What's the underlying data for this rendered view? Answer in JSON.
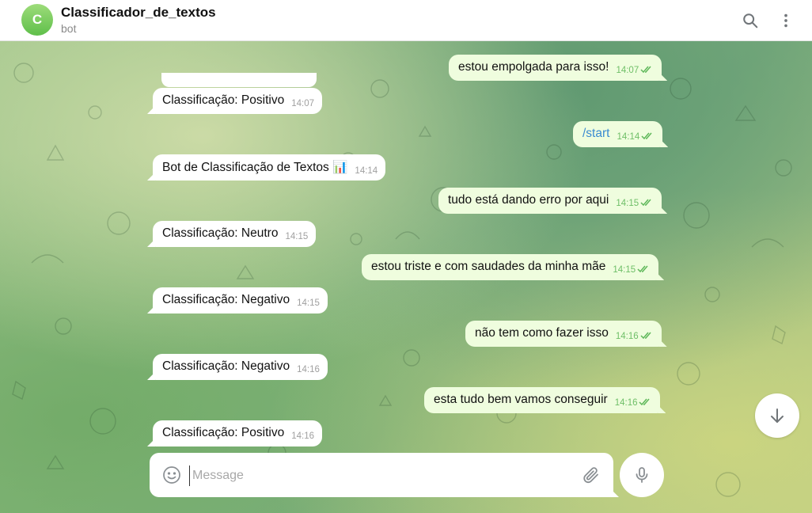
{
  "header": {
    "avatar_letter": "C",
    "title": "Classificador_de_textos",
    "subtitle": "bot",
    "search_icon": "search-icon",
    "menu_icon": "more-vertical-icon"
  },
  "messages": [
    {
      "dir": "out",
      "text": "estou empolgada para isso!",
      "time": "14:07"
    },
    {
      "dir": "in",
      "text": "Classificação: Positivo",
      "time": "14:07"
    },
    {
      "dir": "out",
      "text": "/start",
      "time": "14:14"
    },
    {
      "dir": "in",
      "text": "Bot de Classificação de Textos 📊",
      "time": "14:14"
    },
    {
      "dir": "out",
      "text": "tudo está dando erro por aqui",
      "time": "14:15"
    },
    {
      "dir": "in",
      "text": "Classificação: Neutro",
      "time": "14:15"
    },
    {
      "dir": "out",
      "text": "estou triste e com saudades da minha mãe",
      "time": "14:15"
    },
    {
      "dir": "in",
      "text": "Classificação: Negativo",
      "time": "14:15"
    },
    {
      "dir": "out",
      "text": "não tem como fazer isso",
      "time": "14:16"
    },
    {
      "dir": "in",
      "text": "Classificação: Negativo",
      "time": "14:16"
    },
    {
      "dir": "out",
      "text": "esta tudo bem vamos conseguir",
      "time": "14:16"
    },
    {
      "dir": "in",
      "text": "Classificação: Positivo",
      "time": "14:16"
    }
  ],
  "composer": {
    "placeholder": "Message",
    "value": "",
    "emoji_icon": "smiley-icon",
    "attach_icon": "paperclip-icon",
    "mic_icon": "microphone-icon"
  },
  "scroll_down_icon": "arrow-down-icon",
  "colors": {
    "incoming_bubble": "#ffffff",
    "outgoing_bubble": "#effdde",
    "outgoing_meta": "#6fbf68",
    "command_link": "#3a8bd1",
    "avatar": "#6ecb5a"
  }
}
